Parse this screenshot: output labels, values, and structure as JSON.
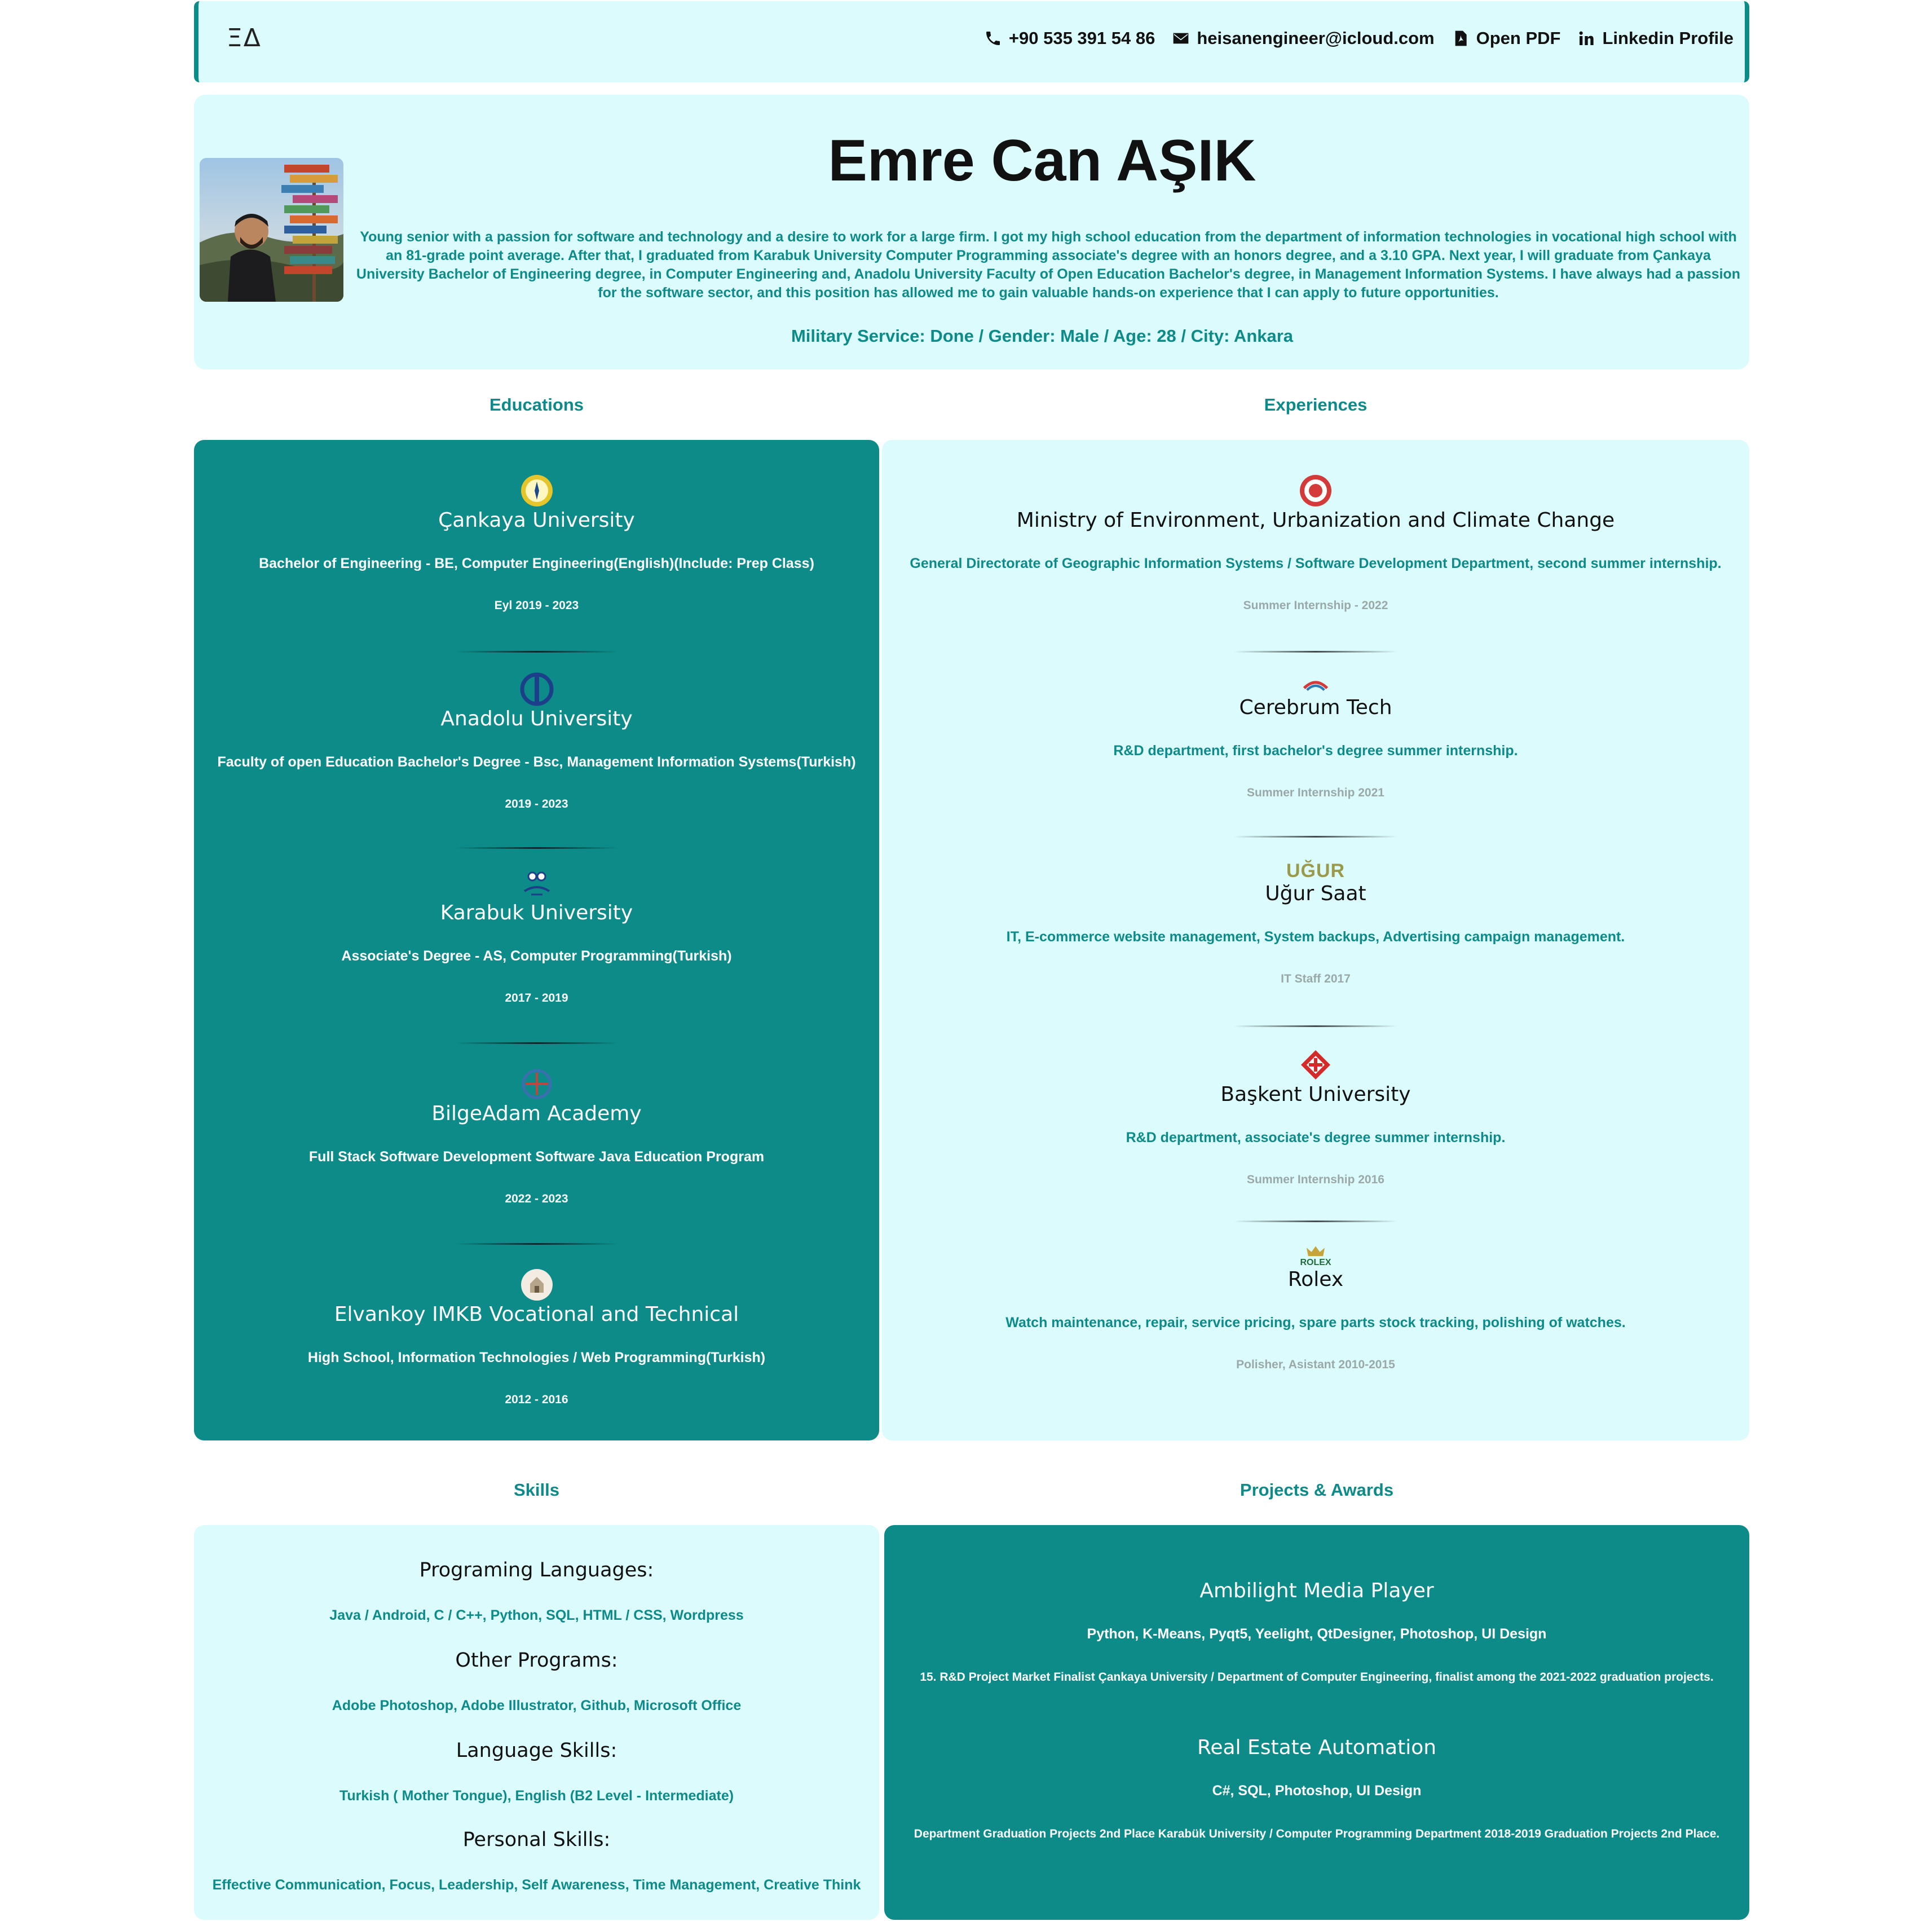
{
  "header": {
    "logo": "ΞΔ",
    "phone": "+90 535 391 54 86",
    "email": "heisanengineer@icloud.com",
    "pdf": "Open PDF",
    "linkedin": "Linkedin Profile"
  },
  "profile": {
    "name": "Emre Can AŞIK",
    "summary": "Young senior with a passion for software and technology and a desire to work for a large firm. I got my high school education from the department of information technologies in vocational high school with an 81-grade point average. After that, I graduated from Karabuk University Computer Programming associate's degree with an honors degree, and a 3.10 GPA. Next year, I will graduate from Çankaya University Bachelor of Engineering degree, in Computer Engineering and, Anadolu University Faculty of Open Education Bachelor's degree, in Management Information Systems. I have always had a passion for the software sector, and this position has allowed me to gain valuable hands-on experience that I can apply to future opportunities.",
    "facts": "Military Service: Done / Gender: Male / Age: 28 / City: Ankara"
  },
  "sections": {
    "educations": "Educations",
    "experiences": "Experiences",
    "skills": "Skills",
    "projects": "Projects & Awards"
  },
  "educations": [
    {
      "org": "Çankaya University",
      "detail": "Bachelor of Engineering - BE, Computer Engineering(English)(Include: Prep Class)",
      "date": "Eyl 2019 - 2023",
      "icon": "cankaya-logo"
    },
    {
      "org": "Anadolu University",
      "detail": "Faculty of open Education Bachelor's Degree - Bsc, Management Information Systems(Turkish)",
      "date": "2019 - 2023",
      "icon": "anadolu-logo"
    },
    {
      "org": "Karabuk University",
      "detail": "Associate's Degree - AS, Computer Programming(Turkish)",
      "date": "2017 - 2019",
      "icon": "karabuk-logo"
    },
    {
      "org": "BilgeAdam Academy",
      "detail": "Full Stack Software Development Software Java Education Program",
      "date": "2022 - 2023",
      "icon": "bilgeadam-logo"
    },
    {
      "org": "Elvankoy IMKB Vocational and Technical",
      "detail": "High School, Information Technologies / Web Programming(Turkish)",
      "date": "2012 - 2016",
      "icon": "elvankoy-logo"
    }
  ],
  "experiences": [
    {
      "org": "Ministry of Environment, Urbanization and Climate Change",
      "detail": "General Directorate of Geographic Information Systems / Software Development Department, second summer internship.",
      "date": "Summer Internship - 2022",
      "icon": "ministry-logo"
    },
    {
      "org": "Cerebrum Tech",
      "detail": "R&D department, first bachelor's degree summer internship.",
      "date": "Summer Internship 2021",
      "icon": "cerebrum-logo"
    },
    {
      "org": "Uğur Saat",
      "detail": "IT, E-commerce website management, System backups, Advertising campaign management.",
      "date": "IT Staff 2017",
      "icon": "ugur-saat-logo",
      "logo_text": "UĞUR"
    },
    {
      "org": "Başkent University",
      "detail": "R&D department, associate's degree summer internship.",
      "date": "Summer Internship 2016",
      "icon": "baskent-logo"
    },
    {
      "org": "Rolex",
      "detail": "Watch maintenance, repair, service pricing, spare parts stock tracking, polishing of watches.",
      "date": "Polisher, Asistant 2010-2015",
      "icon": "rolex-logo",
      "logo_text": "ROLEX"
    }
  ],
  "skills": [
    {
      "heading": "Programing Languages:",
      "value": "Java / Android, C / C++, Python, SQL, HTML / CSS, Wordpress"
    },
    {
      "heading": "Other Programs:",
      "value": "Adobe Photoshop, Adobe Illustrator, Github, Microsoft Office"
    },
    {
      "heading": "Language Skills:",
      "value": "Turkish ( Mother Tongue), English (B2 Level - Intermediate)"
    },
    {
      "heading": "Personal Skills:",
      "value": "Effective Communication, Focus, Leadership, Self Awareness, Time Management, Creative Think"
    }
  ],
  "projects": [
    {
      "title": "Ambilight Media Player",
      "tech": "Python, K-Means, Pyqt5, Yeelight, QtDesigner, Photoshop, UI Design",
      "award": "15. R&D Project Market Finalist Çankaya University / Department of Computer Engineering, finalist among the 2021-2022 graduation projects."
    },
    {
      "title": "Real Estate Automation",
      "tech": "C#, SQL, Photoshop, UI Design",
      "award": "Department Graduation Projects 2nd Place Karabük University / Computer Programming Department 2018-2019 Graduation Projects 2nd Place."
    }
  ],
  "colors": {
    "accent": "#0d8b88",
    "panel_light": "#dcfbfc",
    "text": "#111111"
  }
}
